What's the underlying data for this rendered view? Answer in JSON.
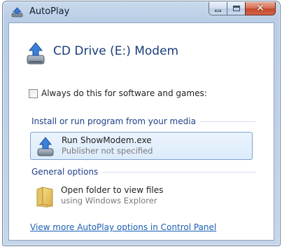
{
  "window": {
    "title": "AutoPlay",
    "close_glyph": "✕"
  },
  "header": {
    "drive_title": "CD Drive (E:) Modem"
  },
  "always_checkbox": {
    "label": "Always do this for software and games:",
    "checked": false
  },
  "sections": {
    "install": {
      "heading": "Install or run program from your media",
      "option": {
        "main": "Run ShowModem.exe",
        "sub": "Publisher not specified",
        "selected": true
      }
    },
    "general": {
      "heading": "General options",
      "option": {
        "main": "Open folder to view files",
        "sub": "using Windows Explorer"
      }
    }
  },
  "footer_link": "View more AutoPlay options in Control Panel",
  "icons": {
    "title": "autoplay-icon",
    "drive": "cd-drive-icon",
    "run": "cd-drive-icon",
    "folder": "folder-icon"
  },
  "colors": {
    "heading_blue": "#1e3f86",
    "link_blue": "#1a5fb4",
    "selection_border": "#7da2ce",
    "close_red": "#c34a2a"
  }
}
